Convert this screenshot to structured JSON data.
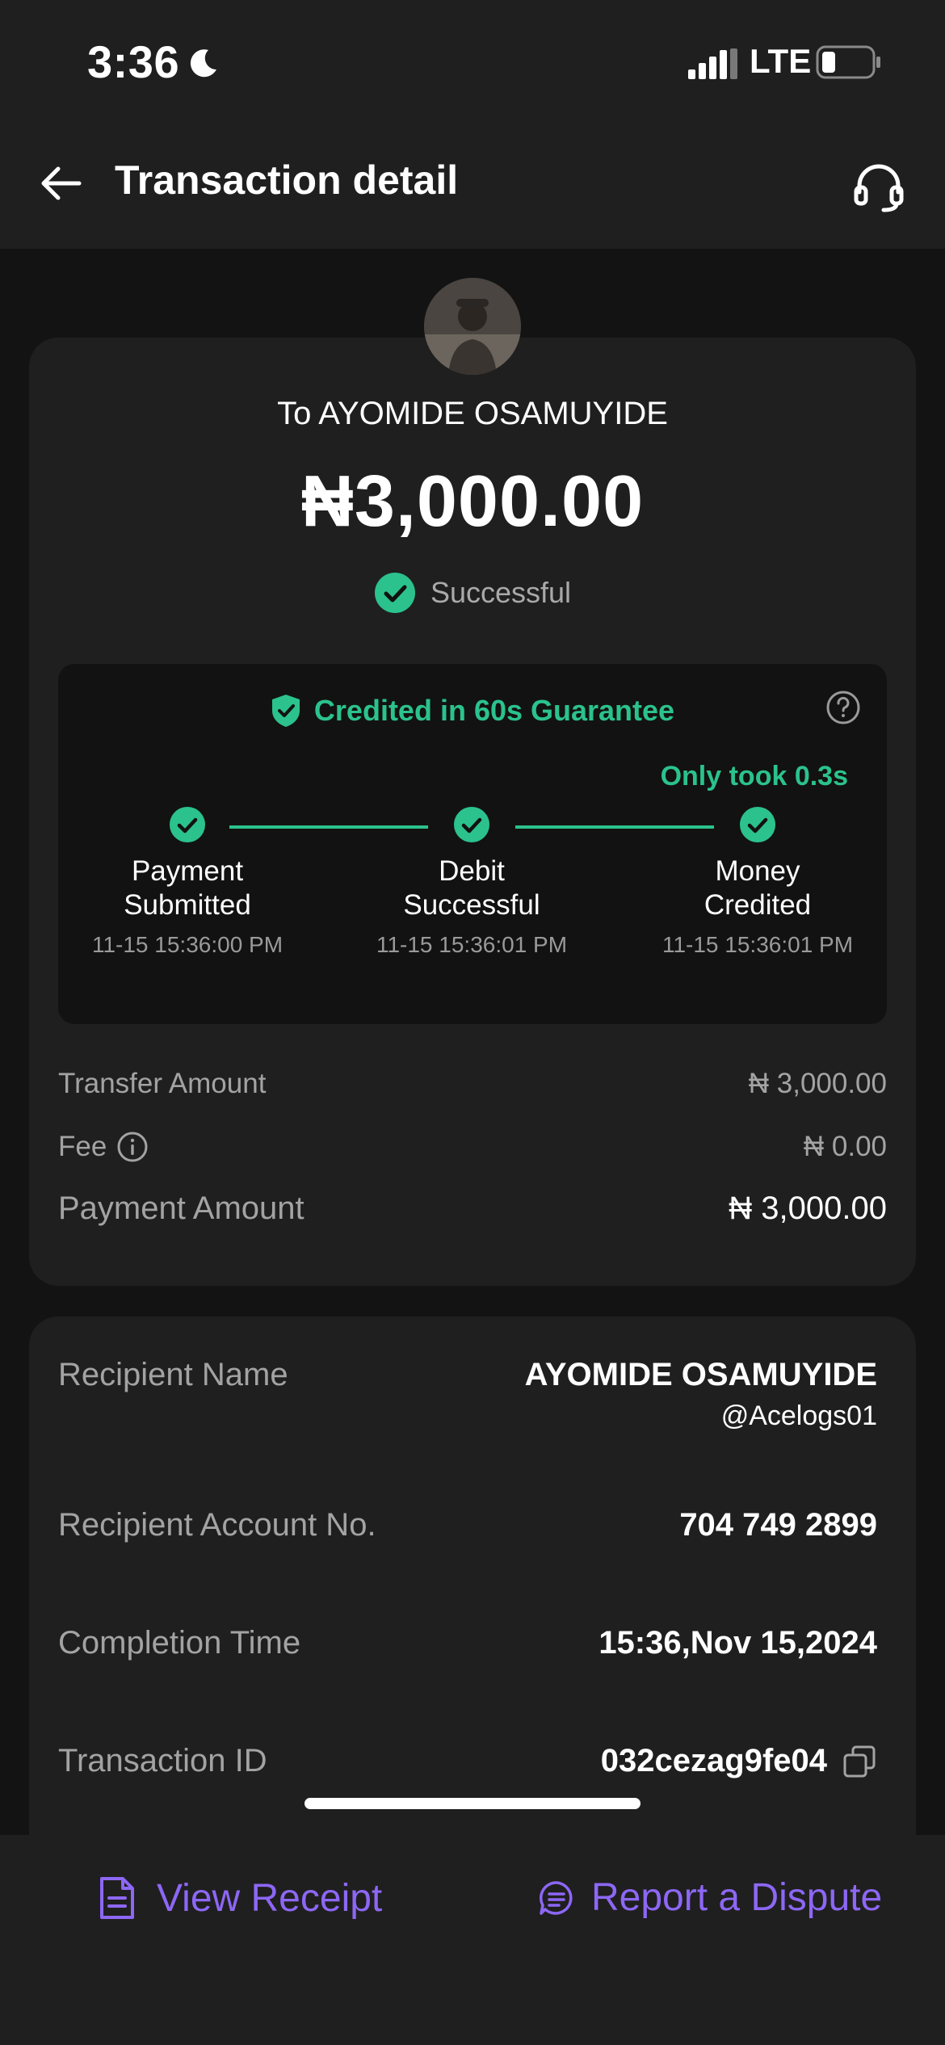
{
  "status_bar": {
    "time": "3:36",
    "network": "LTE"
  },
  "header": {
    "title": "Transaction detail"
  },
  "summary": {
    "recipient_line": "To AYOMIDE OSAMUYIDE",
    "amount": "₦3,000.00",
    "status": "Successful"
  },
  "guarantee": {
    "label": "Credited in 60s Guarantee",
    "took": "Only took 0.3s",
    "steps": [
      {
        "label_line1": "Payment",
        "label_line2": "Submitted",
        "time": "11-15 15:36:00 PM"
      },
      {
        "label_line1": "Debit",
        "label_line2": "Successful",
        "time": "11-15 15:36:01 PM"
      },
      {
        "label_line1": "Money",
        "label_line2": "Credited",
        "time": "11-15 15:36:01 PM"
      }
    ]
  },
  "fees": {
    "transfer_label": "Transfer Amount",
    "transfer_value": "₦ 3,000.00",
    "fee_label": "Fee",
    "fee_value": "₦ 0.00",
    "payment_label": "Payment Amount",
    "payment_value": "₦ 3,000.00"
  },
  "details": {
    "recipient_name_label": "Recipient Name",
    "recipient_name": "AYOMIDE OSAMUYIDE",
    "recipient_handle": "@Acelogs01",
    "account_label": "Recipient Account No.",
    "account_value": "704 749 2899",
    "completion_label": "Completion Time",
    "completion_value": "15:36,Nov 15,2024",
    "txn_label": "Transaction ID",
    "txn_value": "032cezag9fe04"
  },
  "actions": {
    "receipt": "View Receipt",
    "dispute": "Report a Dispute"
  },
  "colors": {
    "accent_green": "#2bc28d",
    "accent_purple": "#8d67f5",
    "card_bg": "#1f1f1f",
    "page_bg": "#131313"
  },
  "icons": [
    "moon-icon",
    "signal-icon",
    "battery-icon",
    "back-arrow-icon",
    "headset-icon",
    "check-circle-icon",
    "shield-check-icon",
    "help-icon",
    "info-icon",
    "copy-icon",
    "receipt-icon",
    "dispute-icon"
  ]
}
